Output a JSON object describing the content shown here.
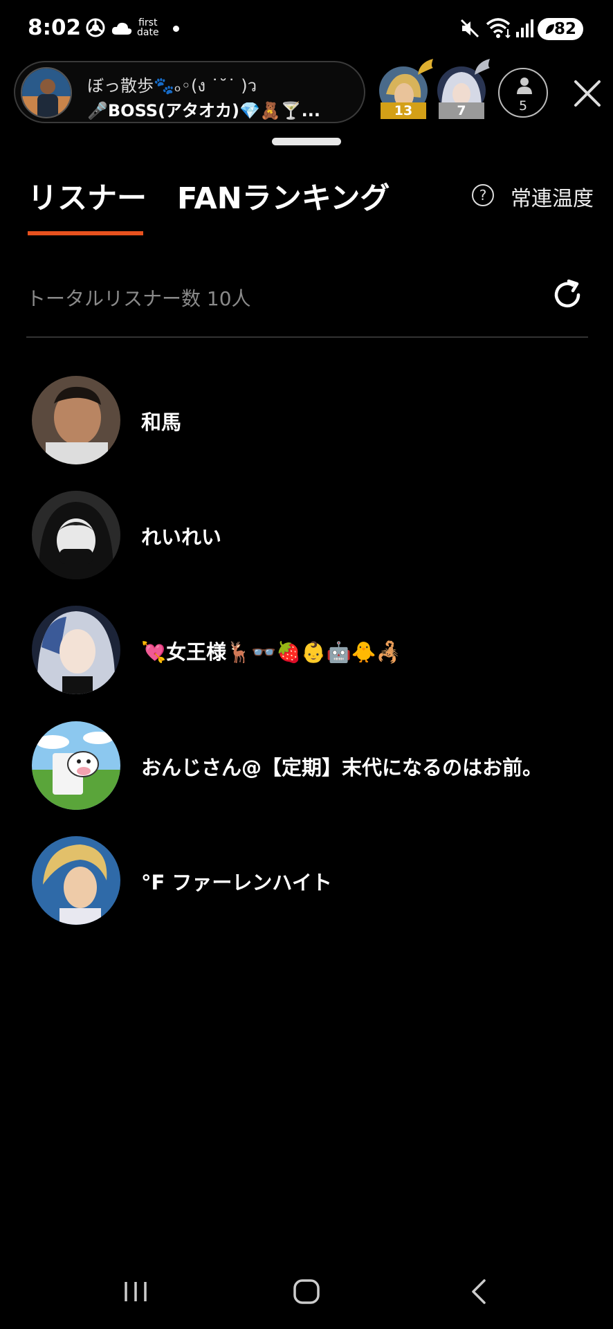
{
  "status_bar": {
    "time": "8:02",
    "first_date_line1": "first",
    "first_date_line2": "date",
    "battery": "82"
  },
  "live_header": {
    "title": "ぼっ散歩🐾ₒ◦(ง ˙˘˙ )ว",
    "subtitle": "🎤BOSS(アタオカ)💎🧸🍸...",
    "rank1_badge": "13",
    "rank2_badge": "7",
    "listener_count": "5"
  },
  "tabs": [
    {
      "label": "リスナー",
      "active": true
    },
    {
      "label": "FANランキング",
      "active": false
    }
  ],
  "help_label": "?",
  "regular_temperature_label": "常連温度",
  "total_listeners": "トータルリスナー数 10人",
  "listeners": [
    {
      "name": "和馬",
      "avatar": "photo-man"
    },
    {
      "name": "れいれい",
      "avatar": "anime-dark-girl"
    },
    {
      "name": "💘女王様🦌👓🍓👶🤖🐥🦂",
      "avatar": "anime-silver-girl"
    },
    {
      "name": "おんじさん@【定期】末代になるのはお前。",
      "avatar": "milk-cow"
    },
    {
      "name": "°F ファーレンハイト",
      "avatar": "blond-hero"
    }
  ],
  "colors": {
    "accent": "#e8511e",
    "gold_badge": "#d4a017",
    "silver_badge": "#9a9a9a",
    "muted_text": "#8a8a8a"
  }
}
